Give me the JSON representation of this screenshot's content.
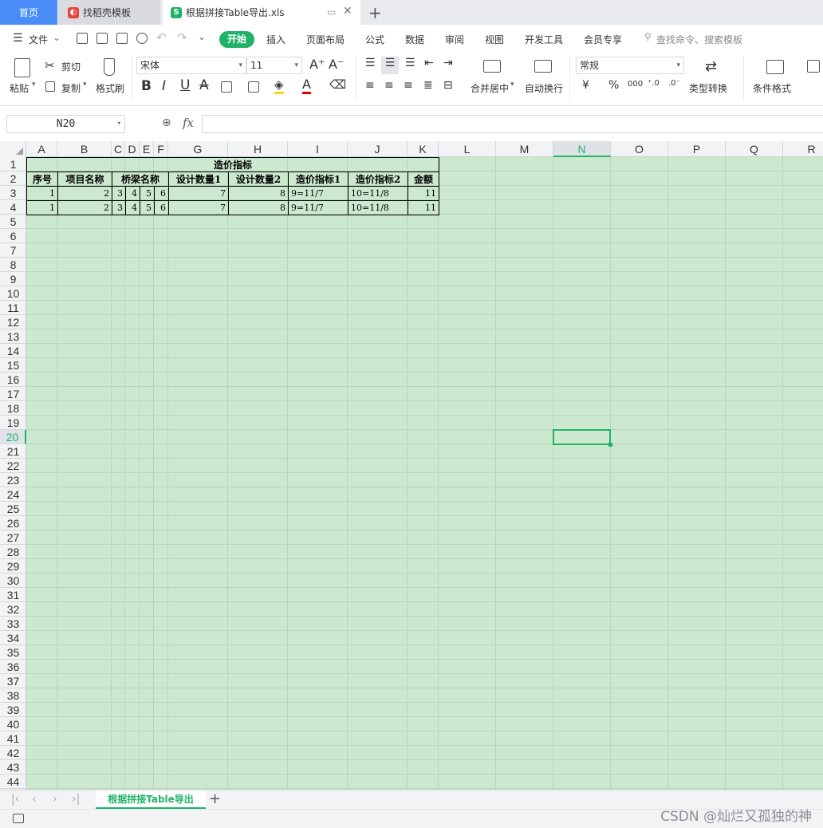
{
  "tabs": {
    "home": "首页",
    "template": "找稻壳模板",
    "doc": "根据拼接Table导出.xls"
  },
  "menu": {
    "file": "文件",
    "items": [
      "开始",
      "插入",
      "页面布局",
      "公式",
      "数据",
      "审阅",
      "视图",
      "开发工具",
      "会员专享"
    ],
    "search": "查找命令、搜索模板"
  },
  "ribbon": {
    "paste": "粘贴",
    "cut": "剪切",
    "copy": "复制",
    "format_painter": "格式刷",
    "font_name": "宋体",
    "font_size": "11",
    "merge_center": "合并居中",
    "wrap_text": "自动换行",
    "number_format": "常规",
    "convert_type": "类型转换",
    "cond_format": "条件格式",
    "currency": "¥",
    "percent": "%",
    "thousands": "000"
  },
  "formula_bar": {
    "name_box": "N20",
    "fx": "fx",
    "content": ""
  },
  "grid": {
    "columns": [
      "A",
      "B",
      "C",
      "D",
      "E",
      "F",
      "G",
      "H",
      "I",
      "J",
      "K",
      "L",
      "M",
      "N",
      "O",
      "P",
      "Q",
      "R"
    ],
    "active_col": "N",
    "active_row": 20,
    "row_count": 44,
    "title": "造价指标",
    "header": [
      "序号",
      "项目名称",
      "桥梁名称",
      "设计数量1",
      "设计数量2",
      "造价指标1",
      "造价指标2",
      "金额"
    ],
    "rows": [
      [
        "1",
        "2",
        "3",
        "4",
        "5",
        "6",
        "7",
        "8",
        "9=11/7",
        "10=11/8",
        "11"
      ],
      [
        "1",
        "2",
        "3",
        "4",
        "5",
        "6",
        "7",
        "8",
        "9=11/7",
        "10=11/8",
        "11"
      ]
    ]
  },
  "sheet": {
    "tab": "根据拼接Table导出"
  },
  "watermark": "CSDN @灿烂又孤独的神"
}
